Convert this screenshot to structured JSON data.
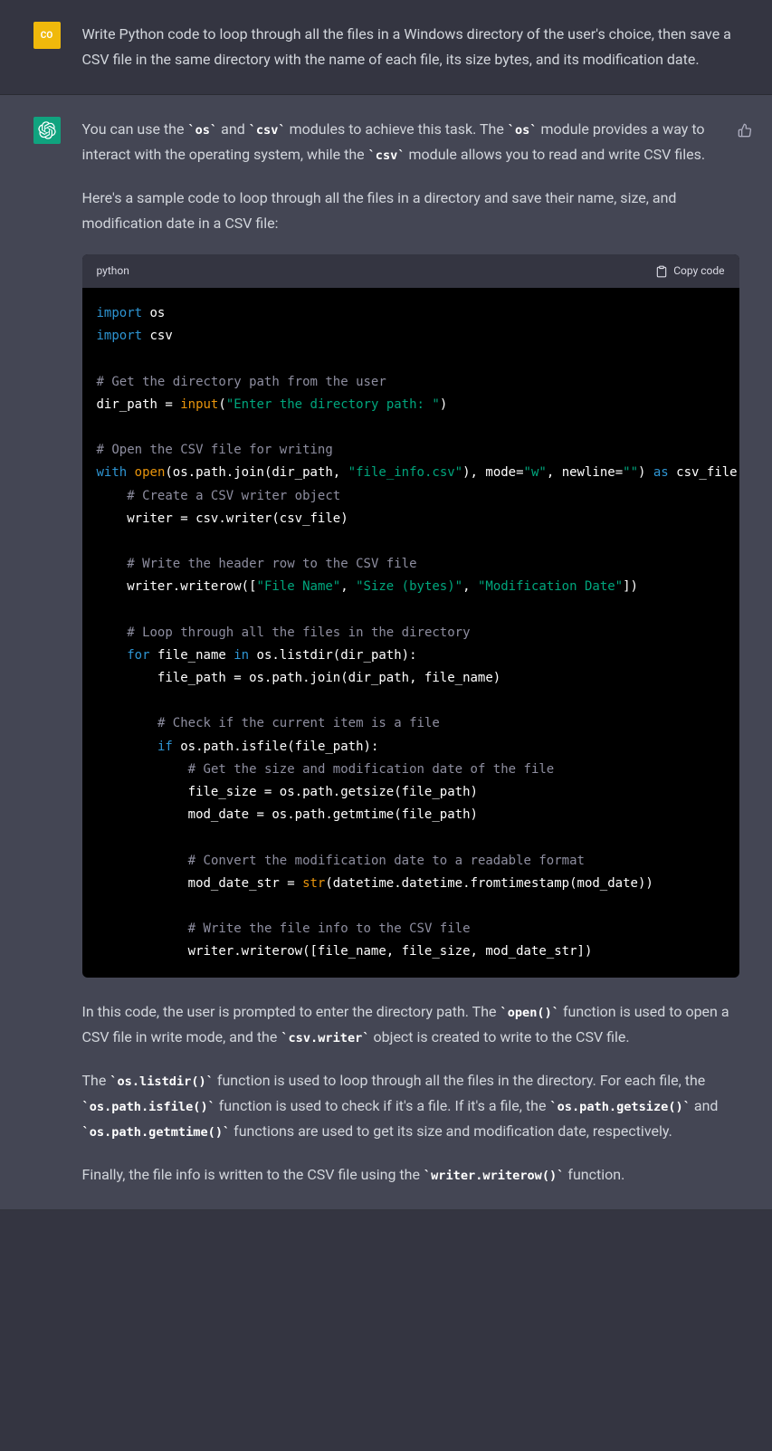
{
  "user": {
    "avatar_label": "CO",
    "prompt": "Write Python code to loop through all the files in a Windows directory of the user's choice, then save a CSV file in the same directory with the name of each file, its size bytes, and its modification date."
  },
  "assistant": {
    "intro_pre": "You can use the ",
    "code_os": "os",
    "intro_mid1": " and ",
    "code_csv": "csv",
    "intro_mid2": " modules to achieve this task. The ",
    "intro_mid3": " module provides a way to interact with the operating system, while the ",
    "intro_end": " module allows you to read and write CSV files.",
    "para2": "Here's a sample code to loop through all the files in a directory and save their name, size, and modification date in a CSV file:",
    "codeblock": {
      "lang": "python",
      "copy_label": "Copy code"
    },
    "expl1_pre": "In this code, the user is prompted to enter the directory path. The ",
    "code_open": "open()",
    "expl1_mid": " function is used to open a CSV file in write mode, and the ",
    "code_writer": "csv.writer",
    "expl1_end": " object is created to write to the CSV file.",
    "expl2_pre": "The ",
    "code_listdir": "os.listdir()",
    "expl2_mid1": " function is used to loop through all the files in the directory. For each file, the ",
    "code_isfile": "os.path.isfile()",
    "expl2_mid2": " function is used to check if it's a file. If it's a file, the ",
    "code_getsize": "os.path.getsize()",
    "expl2_mid3": " and ",
    "code_getmtime": "os.path.getmtime()",
    "expl2_end": " functions are used to get its size and modification date, respectively.",
    "expl3_pre": "Finally, the file info is written to the CSV file using the ",
    "code_writerow": "writer.writerow()",
    "expl3_end": " function."
  }
}
